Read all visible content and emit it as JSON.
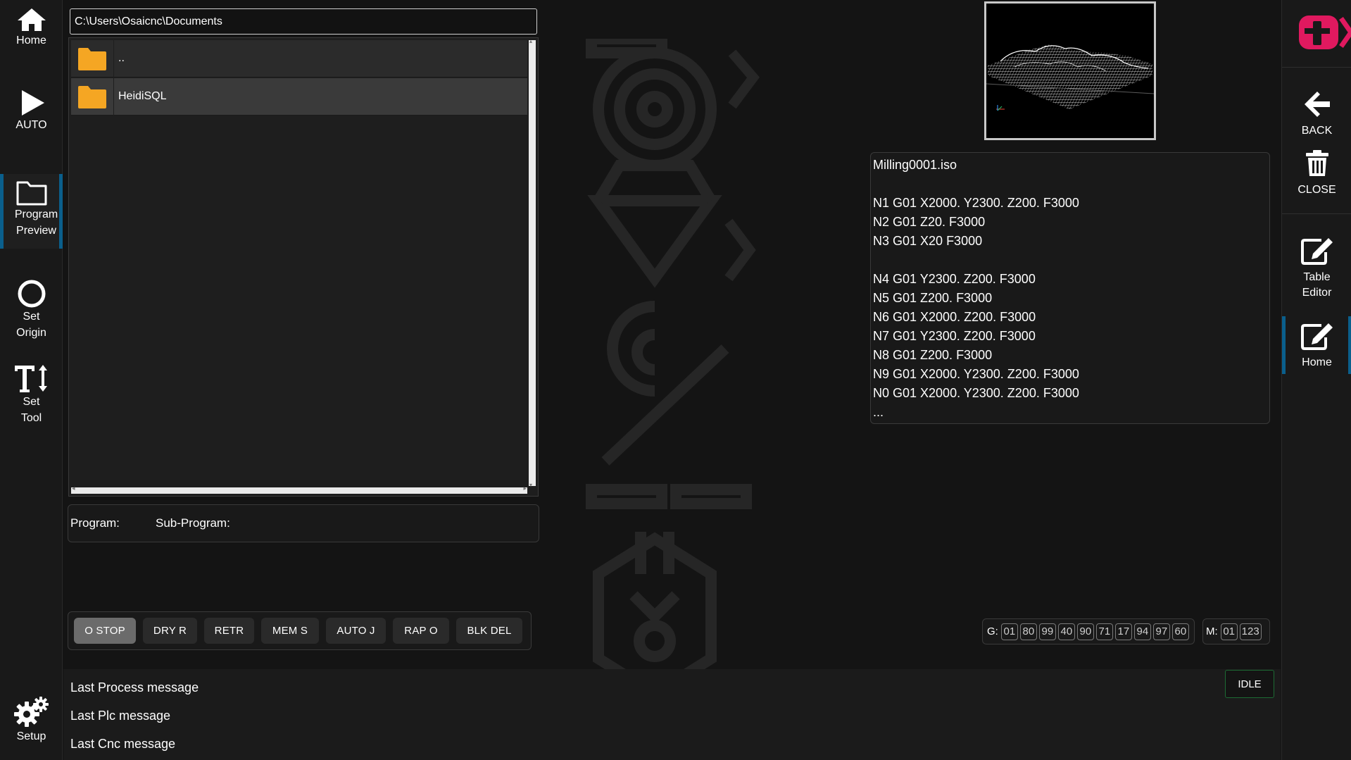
{
  "left_nav": {
    "home": "Home",
    "auto": "AUTO",
    "program_preview_1": "Program",
    "program_preview_2": "Preview",
    "set_origin_1": "Set",
    "set_origin_2": "Origin",
    "set_tool_1": "Set",
    "set_tool_2": "Tool",
    "setup": "Setup"
  },
  "right_nav": {
    "back": "BACK",
    "close": "CLOSE",
    "table_editor_1": "Table",
    "table_editor_2": "Editor",
    "home": "Home"
  },
  "file_browser": {
    "path": "C:\\Users\\Osaicnc\\Documents",
    "entries": [
      {
        "name": "..",
        "type": "folder-icon",
        "selected": false
      },
      {
        "name": "HeidiSQL",
        "type": "folder-icon",
        "selected": true
      }
    ]
  },
  "program_info": {
    "program_label": "Program:",
    "subprogram_label": "Sub-Program:"
  },
  "mode_buttons": [
    "O STOP",
    "DRY R",
    "RETR",
    "MEM S",
    "AUTO J",
    "RAP O",
    "BLK DEL"
  ],
  "program": {
    "filename": "Milling0001.iso",
    "lines": [
      "",
      "N1 G01 X2000. Y2300. Z200. F3000",
      "N2 G01 Z20. F3000",
      "N3 G01 X20 F3000",
      "",
      "N4 G01 Y2300. Z200. F3000",
      "N5 G01 Z200. F3000",
      "N6 G01 X2000. Z200. F3000",
      "N7 G01 Y2300. Z200. F3000",
      "N8 G01 Z200. F3000",
      "N9 G01 X2000. Y2300. Z200. F3000",
      "N0 G01 X2000. Y2300. Z200. F3000",
      "..."
    ]
  },
  "g_codes": {
    "label": "G:",
    "values": [
      "01",
      "80",
      "99",
      "40",
      "90",
      "71",
      "17",
      "94",
      "97",
      "60"
    ]
  },
  "m_codes": {
    "label": "M:",
    "values": [
      "01",
      "123"
    ]
  },
  "messages": {
    "process": "Last Process message",
    "plc": "Last Plc message",
    "cnc": "Last Cnc message"
  },
  "status": "IDLE",
  "colors": {
    "accent": "#0a5f8c",
    "folder": "#f5a623",
    "brand": "#e0195f",
    "status_border": "#1d6b34"
  }
}
